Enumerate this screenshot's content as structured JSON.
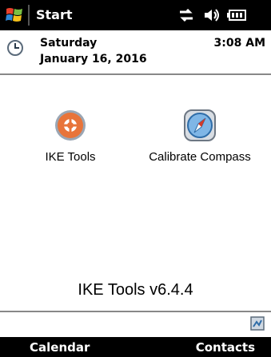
{
  "titlebar": {
    "start_label": "Start"
  },
  "today": {
    "day": "Saturday",
    "date": "January 16, 2016",
    "time": "3:08 AM"
  },
  "programs": [
    {
      "label": "IKE Tools",
      "icon": "ike-tools-icon"
    },
    {
      "label": "Calibrate Compass",
      "icon": "compass-icon"
    }
  ],
  "version_text": "IKE Tools v6.4.4",
  "softkeys": {
    "left": "Calendar",
    "right": "Contacts"
  },
  "colors": {
    "bar": "#000000",
    "ike_orange": "#E8743A",
    "compass_blue": "#3C8AC6"
  }
}
